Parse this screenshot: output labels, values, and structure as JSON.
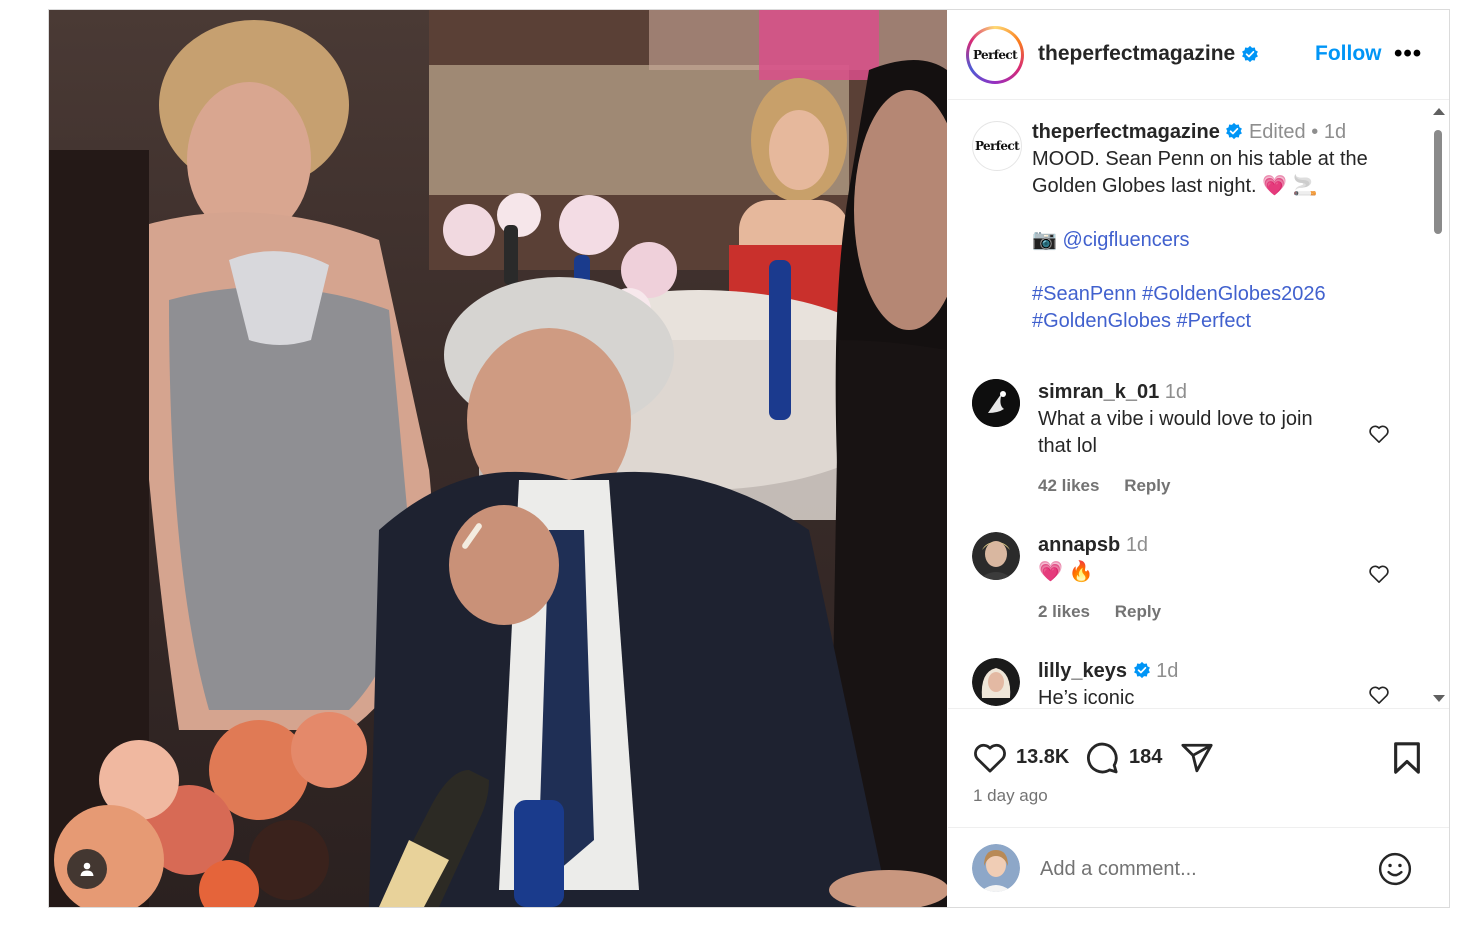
{
  "post": {
    "account": "theperfectmagazine",
    "logo_text": "Perfect",
    "follow_label": "Follow",
    "more_label": "•••",
    "caption": {
      "username": "theperfectmagazine",
      "edited": "Edited",
      "dot": "•",
      "time": "1d",
      "text": "MOOD. Sean Penn on his table at the Golden Globes last night. 💗 🚬",
      "camera_emoji": "📷",
      "mention": "@cigfluencers",
      "hashtags_line1": "#SeanPenn #GoldenGlobes2026",
      "hashtags_line2": "#GoldenGlobes #Perfect"
    },
    "comments": [
      {
        "username": "simran_k_01",
        "time": "1d",
        "text": "What a vibe i would love to join that lol",
        "likes": "42 likes",
        "reply": "Reply",
        "verified": false
      },
      {
        "username": "annapsb",
        "time": "1d",
        "text": "💗 🔥",
        "likes": "2 likes",
        "reply": "Reply",
        "verified": false
      },
      {
        "username": "lilly_keys",
        "time": "1d",
        "text": "He’s iconic",
        "verified": true
      }
    ],
    "likes_count": "13.8K",
    "comments_count": "184",
    "posted_ago": "1 day ago",
    "add_comment_placeholder": "Add a comment..."
  },
  "colors": {
    "link": "#4161ce",
    "follow": "#0095f6",
    "verified": "#0095f6",
    "muted": "#737373"
  },
  "icons": [
    "verified-badge-icon",
    "more-options-icon",
    "heart-icon",
    "comment-icon",
    "share-icon",
    "save-icon",
    "emoji-icon",
    "user-tag-icon",
    "scroll-up-icon",
    "scroll-down-icon"
  ]
}
